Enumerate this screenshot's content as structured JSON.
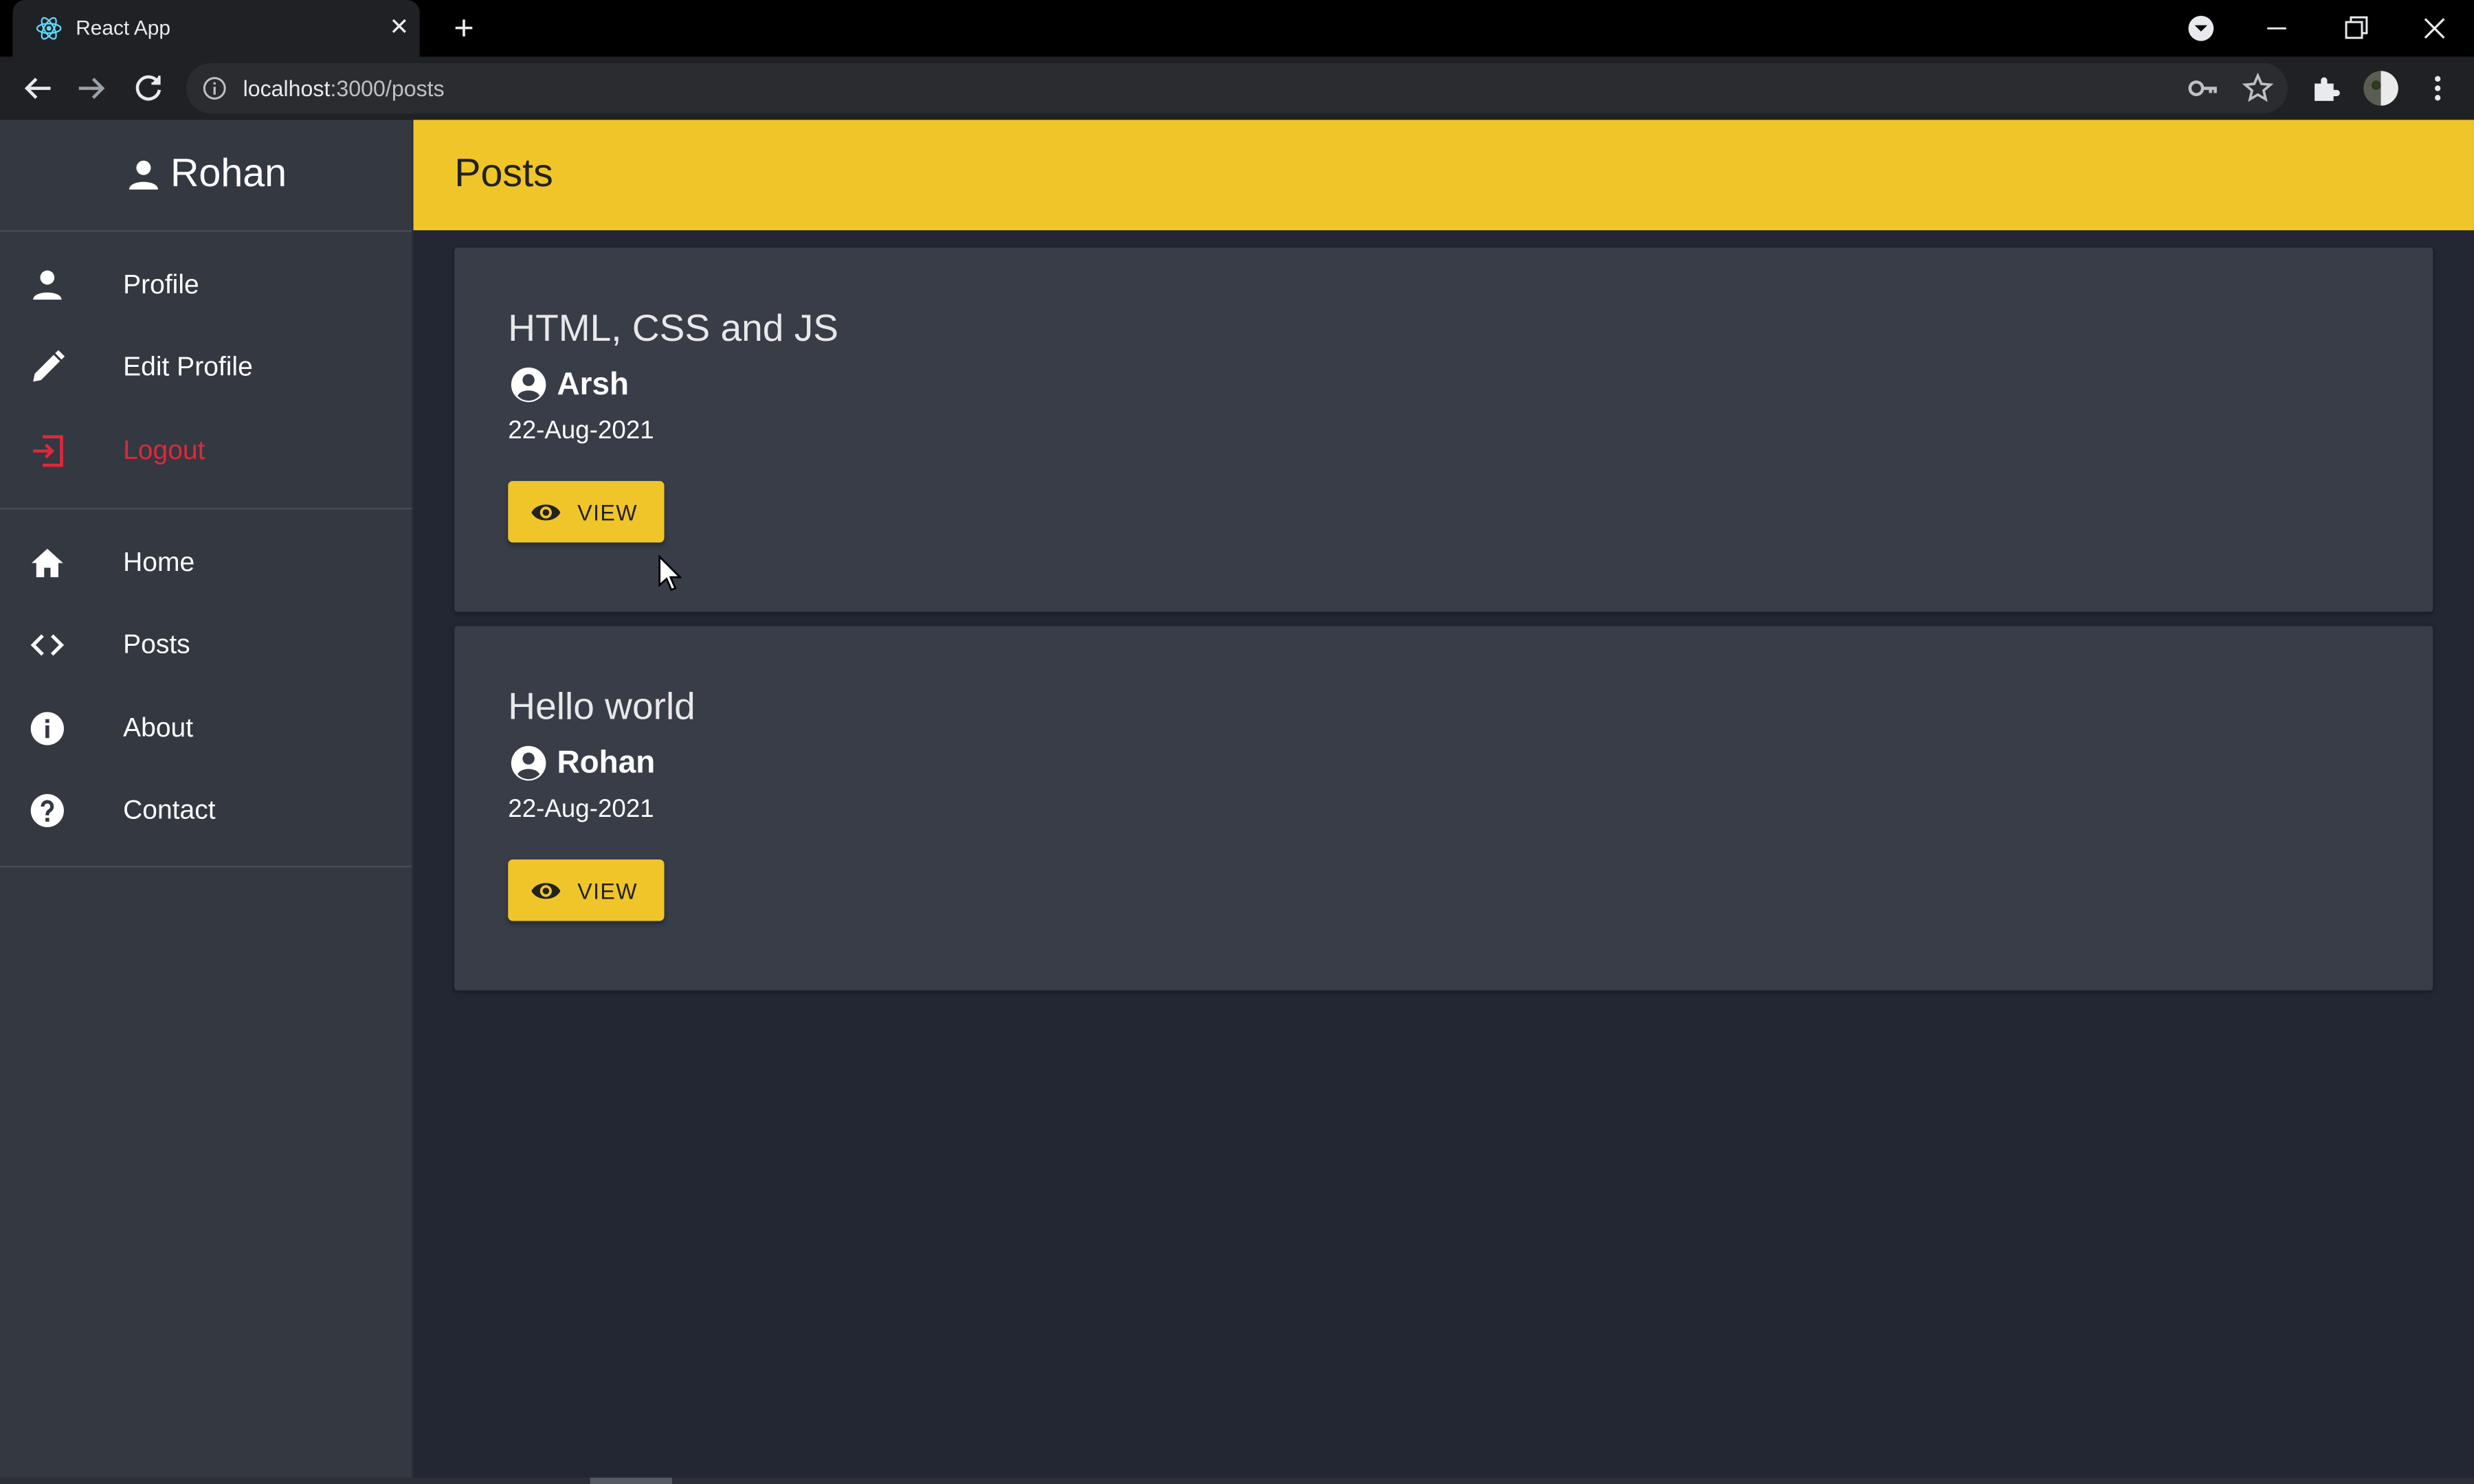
{
  "browser": {
    "tab_title": "React App",
    "tab_favicon": "react-icon",
    "url_host": "localhost",
    "url_path": ":3000/posts"
  },
  "sidebar": {
    "user_name": "Rohan",
    "user_icon": "person-icon",
    "account_items": [
      {
        "label": "Profile",
        "icon": "person-icon"
      },
      {
        "label": "Edit Profile",
        "icon": "pencil-icon"
      },
      {
        "label": "Logout",
        "icon": "logout-icon"
      }
    ],
    "nav_items": [
      {
        "label": "Home",
        "icon": "home-icon"
      },
      {
        "label": "Posts",
        "icon": "code-icon"
      },
      {
        "label": "About",
        "icon": "info-icon"
      },
      {
        "label": "Contact",
        "icon": "help-icon"
      }
    ]
  },
  "header": {
    "title": "Posts"
  },
  "posts": [
    {
      "title": "HTML, CSS and JS",
      "author": "Arsh",
      "date": "22-Aug-2021",
      "button_label": "VIEW"
    },
    {
      "title": "Hello world",
      "author": "Rohan",
      "date": "22-Aug-2021",
      "button_label": "VIEW"
    }
  ],
  "colors": {
    "accent": "#f0c529",
    "sidebar_bg": "#333841",
    "content_bg": "#222733",
    "card_bg": "#383d48",
    "logout": "#e0283a"
  }
}
